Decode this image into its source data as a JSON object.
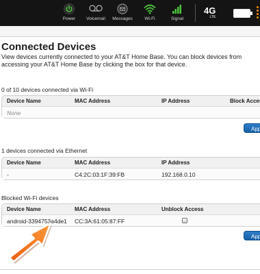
{
  "status_bar": {
    "items": [
      {
        "label": "Power",
        "icon": "power-icon",
        "color": "#4dc43c"
      },
      {
        "label": "Voicemail",
        "icon": "voicemail-icon"
      },
      {
        "label": "Messages",
        "icon": "messages-icon"
      },
      {
        "label": "Wi-Fi",
        "icon": "wifi-icon",
        "color": "#4dc43c"
      },
      {
        "label": "Signal",
        "icon": "signal-icon",
        "color": "#4dc43c"
      }
    ],
    "network": "4G",
    "network_sub": "LTE",
    "battery_icon": "battery-icon"
  },
  "page": {
    "title": "Connected Devices",
    "intro": "View devices currently connected to your AT&T Home Base. You can block devices from accessing your AT&T Home Base by clicking the box for that device."
  },
  "wifi_section": {
    "label": "0 of 10  devices connected via Wi-Fi",
    "headers": [
      "Device Name",
      "MAC Address",
      "IP Address",
      "Block Access"
    ],
    "empty_text": "None",
    "apply_label": "Apply"
  },
  "ethernet_section": {
    "label": "1 devices connected via Ethernet",
    "headers": [
      "Device Name",
      "MAC Address",
      "IP Address"
    ],
    "rows": [
      {
        "name": "-",
        "mac": "C4:2C:03:1F:39:FB",
        "ip": "192.168.0.10"
      }
    ]
  },
  "blocked_section": {
    "label": "Blocked Wi-Fi devices",
    "headers": [
      "Device Name",
      "MAC Address",
      "Unblock Access"
    ],
    "rows": [
      {
        "name": "android-3394753a4de1",
        "mac": "CC:3A:61:05:87:FF",
        "unblock_checked": false
      }
    ],
    "apply_label": "Apply"
  },
  "colors": {
    "accent_orange": "#f47a1f",
    "button_blue": "#1f6fba"
  }
}
